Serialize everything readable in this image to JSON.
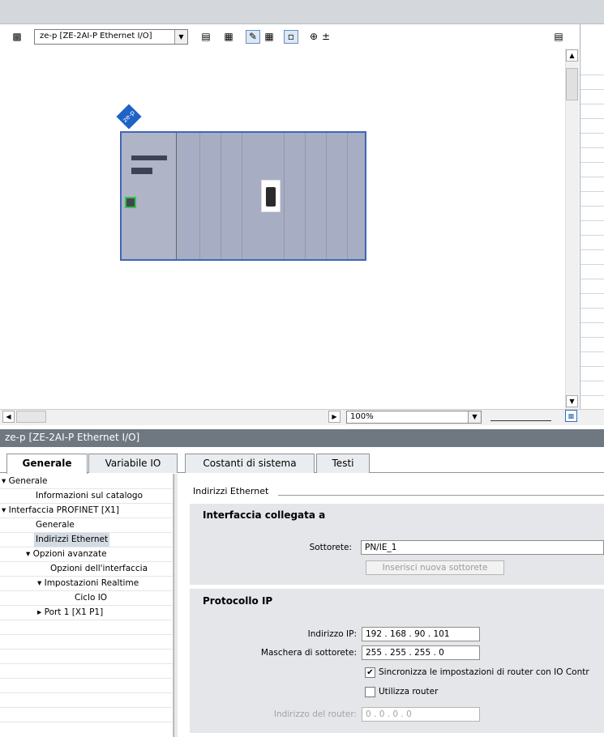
{
  "toolbar": {
    "device_select": "ze-p [ZE-2AI-P Ethernet I/O]"
  },
  "canvas": {
    "device_tag": "ze-p",
    "zoom_value": "100%"
  },
  "properties": {
    "header_title": "ze-p [ZE-2AI-P Ethernet I/O]",
    "tabs": [
      {
        "label": "Generale"
      },
      {
        "label": "Variabile IO"
      },
      {
        "label": "Costanti di sistema"
      },
      {
        "label": "Testi"
      }
    ],
    "nav": [
      {
        "label": "Generale"
      },
      {
        "label": "Informazioni sul catalogo"
      },
      {
        "label": "Interfaccia PROFINET [X1]"
      },
      {
        "label": "Generale"
      },
      {
        "label": "Indirizzi Ethernet"
      },
      {
        "label": "Opzioni avanzate"
      },
      {
        "label": "Opzioni dell'interfaccia"
      },
      {
        "label": "Impostazioni Realtime"
      },
      {
        "label": "Ciclo IO"
      },
      {
        "label": "Port 1 [X1 P1]"
      }
    ],
    "section_title": "Indirizzi Ethernet",
    "interface_group": {
      "title": "Interfaccia collegata a",
      "subnet_label": "Sottorete:",
      "subnet_value": "PN/IE_1",
      "add_subnet_button": "Inserisci nuova sottorete"
    },
    "ip_group": {
      "title": "Protocollo IP",
      "ip_label": "Indirizzo IP:",
      "ip_value": "192 . 168 . 90  . 101",
      "mask_label": "Maschera di sottorete:",
      "mask_value": "255 . 255 . 255 . 0",
      "sync_router_label": "Sincronizza le impostazioni di router con IO Contr",
      "sync_router_checked": true,
      "use_router_label": "Utilizza router",
      "use_router_checked": false,
      "router_label": "Indirizzo del router:",
      "router_value": "0  . 0  . 0  . 0"
    }
  }
}
